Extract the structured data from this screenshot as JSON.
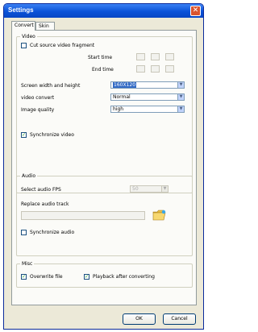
{
  "window": {
    "title": "Settings"
  },
  "tabs": [
    {
      "label": "Convert"
    },
    {
      "label": "Skin"
    }
  ],
  "video": {
    "group_label": "Video",
    "cut_label": "Cut source video fragment",
    "starttime_label": "Start time",
    "endtime_label": "End time",
    "screen_label": "Screen width and height",
    "screen_value": "160X120",
    "convert_label": "video convert",
    "convert_value": "Normal",
    "quality_label": "Image quality",
    "quality_value": "high",
    "sync_label": "Synchronize video"
  },
  "audio": {
    "group_label": "Audio",
    "fps_label": "Select audio FPS",
    "fps_value": "50",
    "replace_label": "Replace audio track",
    "track_value": "",
    "sync_label": "Synchronize audio"
  },
  "misc": {
    "group_label": "Misc",
    "overwrite_label": "Overwrite file",
    "playback_label": "Playback after converting"
  },
  "buttons": {
    "ok": "OK",
    "cancel": "Cancel"
  },
  "colors": {
    "titlebar": "#0a52d8",
    "dialog_bg": "#ece9d8",
    "selection": "#316ac5"
  },
  "checkboxes": {
    "cut_checked": false,
    "sync_video_checked": true,
    "sync_audio_checked": false,
    "overwrite_checked": true,
    "playback_checked": true
  }
}
